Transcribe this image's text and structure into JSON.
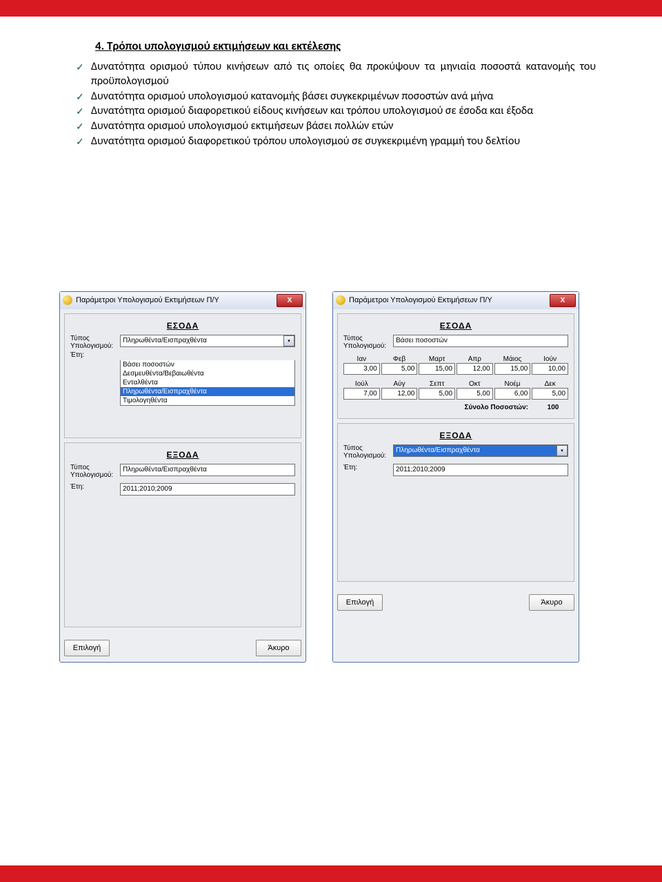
{
  "heading": "4. Τρόποι υπολογισμού εκτιμήσεων και εκτέλεσης",
  "bullets": [
    "Δυνατότητα ορισμού τύπου κινήσεων από τις οποίες θα προκύψουν τα μηνιαία ποσοστά κατανομής του προϋπολογισμού",
    "Δυνατότητα ορισμού υπολογισμού κατανομής βάσει συγκεκριμένων ποσοστών ανά μήνα",
    "Δυνατότητα ορισμού διαφορετικού είδους κινήσεων και τρόπου υπολογισμού σε έσοδα και έξοδα",
    "Δυνατότητα ορισμού υπολογισμού εκτιμήσεων βάσει πολλών ετών",
    "Δυνατότητα ορισμού διαφορετικού τρόπου υπολογισμού σε συγκεκριμένη γραμμή του δελτίου"
  ],
  "dialog": {
    "title": "Παράμετροι Υπολογισμού Εκτιμήσεων Π/Υ",
    "close": "X",
    "esoda_heading": "ΕΣΟΔΑ",
    "exoda_heading": "ΕΞΟΔΑ",
    "lbl_type1": "Τύπος",
    "lbl_type2": "Υπολογισμού:",
    "lbl_years": "Έτη:",
    "btn_select": "Επιλογή",
    "btn_cancel": "Άκυρο"
  },
  "left": {
    "esoda_value": "Πληρωθέντα/Εισπραχθέντα",
    "dropdown": [
      {
        "t": "Βάσει ποσοστών",
        "sel": false
      },
      {
        "t": "Δεσμευθέντα/Βεβαιωθέντα",
        "sel": false
      },
      {
        "t": "Ενταλθέντα",
        "sel": false
      },
      {
        "t": "Πληρωθέντα/Εισπραχθέντα",
        "sel": true
      },
      {
        "t": "Τιμολογηθέντα",
        "sel": false
      }
    ],
    "exoda_value": "Πληρωθέντα/Εισπραχθέντα",
    "exoda_years": "2011;2010;2009"
  },
  "right": {
    "esoda_value": "Βάσει ποσοστών",
    "months_a": {
      "hdr": [
        "Ιαν",
        "Φεβ",
        "Μαρτ",
        "Απρ",
        "Μάιος",
        "Ιούν"
      ],
      "val": [
        "3,00",
        "5,00",
        "15,00",
        "12,00",
        "15,00",
        "10,00"
      ]
    },
    "months_b": {
      "hdr": [
        "Ιούλ",
        "Αύγ",
        "Σεπτ",
        "Οκτ",
        "Νοέμ",
        "Δεκ"
      ],
      "val": [
        "7,00",
        "12,00",
        "5,00",
        "5,00",
        "6,00",
        "5,00"
      ]
    },
    "total_label": "Σύνολο Ποσοστών:",
    "total_value": "100",
    "exoda_value": "Πληρωθέντα/Εισπραχθέντα",
    "exoda_years": "2011;2010;2009"
  }
}
